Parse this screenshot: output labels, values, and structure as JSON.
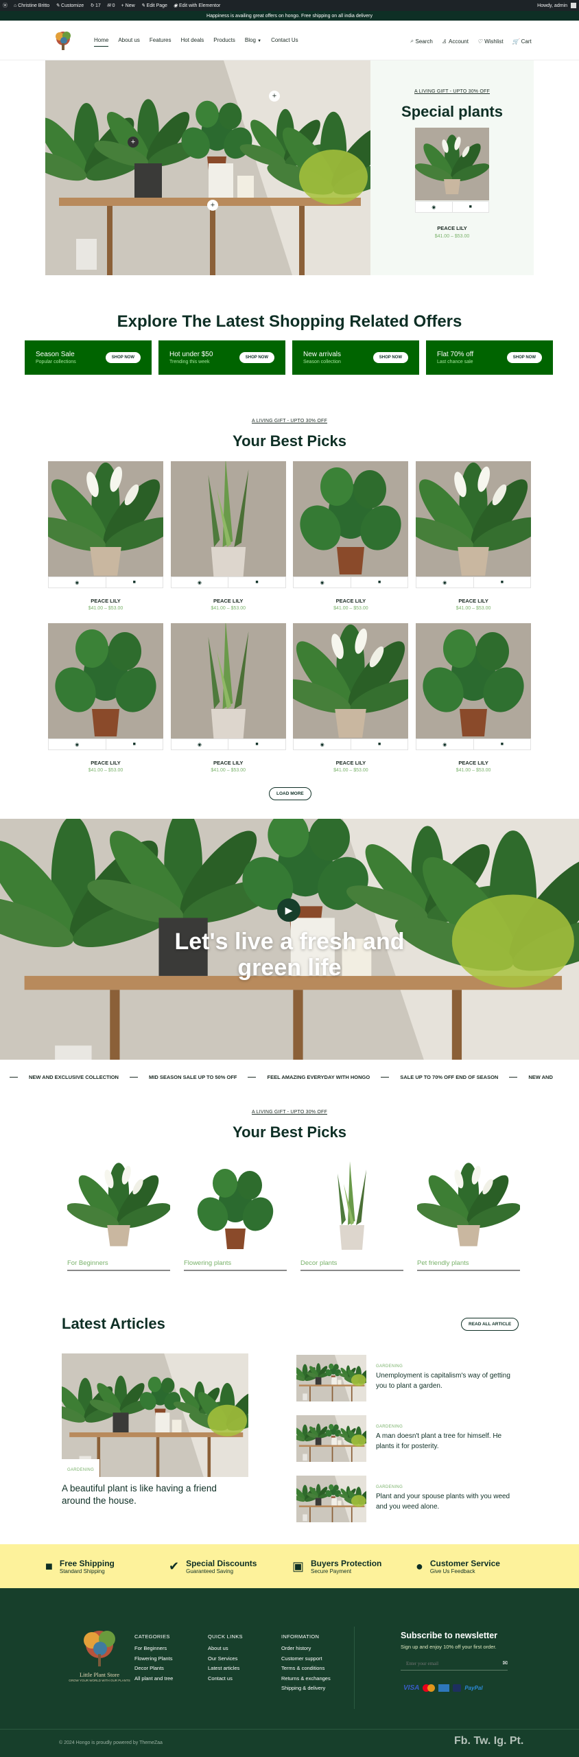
{
  "adminbar": {
    "user": "Christine Britto",
    "customize": "Customize",
    "updates": "17",
    "comments": "0",
    "new": "New",
    "edit": "Edit Page",
    "elementor": "Edit with Elementor",
    "howdy": "Howdy, admin"
  },
  "promo": "Happiness is availing great offers on hongo. Free shipping on all india delivery",
  "nav": {
    "items": [
      "Home",
      "About us",
      "Features",
      "Hot deals",
      "Products",
      "Blog",
      "Contact Us"
    ],
    "tools": {
      "search": "Search",
      "account": "Account",
      "wishlist": "Wishlist",
      "cart": "Cart"
    }
  },
  "hero": {
    "eyebrow": "A LIVING GIFT - UPTO 30% OFF",
    "title": "Special plants",
    "product": {
      "name": "PEACE LILY",
      "price": "$41.00 – $53.00"
    }
  },
  "offers": {
    "title": "Explore The Latest Shopping Related Offers",
    "items": [
      {
        "title": "Season Sale",
        "sub": "Popular collections",
        "btn": "SHOP NOW"
      },
      {
        "title": "Hot under $50",
        "sub": "Trending this week",
        "btn": "SHOP NOW"
      },
      {
        "title": "New arrivals",
        "sub": "Season collection",
        "btn": "SHOP NOW"
      },
      {
        "title": "Flat 70% off",
        "sub": "Last chance sale",
        "btn": "SHOP NOW"
      }
    ]
  },
  "picks": {
    "eyebrow": "A LIVING GIFT - UPTO 30% OFF",
    "title": "Your Best Picks",
    "products": [
      {
        "name": "PEACE LILY",
        "price": "$41.00 – $53.00"
      },
      {
        "name": "PEACE LILY",
        "price": "$41.00 – $53.00"
      },
      {
        "name": "PEACE LILY",
        "price": "$41.00 – $53.00"
      },
      {
        "name": "PEACE LILY",
        "price": "$41.00 – $53.00"
      },
      {
        "name": "PEACE LILY",
        "price": "$41.00 – $53.00"
      },
      {
        "name": "PEACE LILY",
        "price": "$41.00 – $53.00"
      },
      {
        "name": "PEACE LILY",
        "price": "$41.00 – $53.00"
      },
      {
        "name": "PEACE LILY",
        "price": "$41.00 – $53.00"
      }
    ],
    "load_more": "LOAD MORE"
  },
  "banner": {
    "line1": "Let's live a fresh and",
    "line2": "green life"
  },
  "marquee": [
    "NEW AND EXCLUSIVE COLLECTION",
    "MID SEASON SALE UP TO 50% OFF",
    "FEEL AMAZING EVERYDAY WITH HONGO",
    "SALE UP TO 70% OFF END OF SEASON",
    "NEW AND"
  ],
  "categories": {
    "eyebrow": "A LIVING GIFT - UPTO 30% OFF",
    "title": "Your Best Picks",
    "items": [
      "For Beginners",
      "Flowering plants",
      "Decor plants",
      "Pet friendly plants"
    ]
  },
  "articles": {
    "title": "Latest Articles",
    "btn": "READ ALL ARTICLE",
    "main": {
      "tag": "GARDENING",
      "title": "A beautiful plant is like having a friend around the house."
    },
    "side": [
      {
        "tag": "GARDENING",
        "title": "Unemployment is capitalism's way of getting you to plant a garden."
      },
      {
        "tag": "GARDENING",
        "title": "A man doesn't plant a tree for himself. He plants it for posterity."
      },
      {
        "tag": "GARDENING",
        "title": "Plant and your spouse plants with you weed and you weed alone."
      }
    ]
  },
  "features": [
    {
      "title": "Free Shipping",
      "sub": "Standard Shipping"
    },
    {
      "title": "Special Discounts",
      "sub": "Guaranteed Saving"
    },
    {
      "title": "Buyers Protection",
      "sub": "Secure Payment"
    },
    {
      "title": "Customer Service",
      "sub": "Give Us Feedback"
    }
  ],
  "footer": {
    "brand": "Little Plant Store",
    "tagline": "GROW YOUR WORLD WITH OUR PLANTS",
    "cols": [
      {
        "title": "CATEGORIES",
        "links": [
          "For Beginners",
          "Flowering Plants",
          "Decor Plants",
          "All plant and tree"
        ]
      },
      {
        "title": "QUICK LINKS",
        "links": [
          "About us",
          "Our Services",
          "Latest articles",
          "Contact us"
        ]
      },
      {
        "title": "INFORMATION",
        "links": [
          "Order history",
          "Customer support",
          "Terms & conditions",
          "Returns & exchanges",
          "Shipping & delivery"
        ]
      }
    ],
    "newsletter": {
      "title": "Subscribe to newsletter",
      "sub": "Sign up and enjoy 10% off your first order.",
      "placeholder": "Enter your email"
    },
    "payments": [
      "VISA",
      "",
      "",
      "",
      "PayPal"
    ],
    "copyright": "© 2024 Hongo is proudly powered by ThemeZaa",
    "social": "Fb. Tw. Ig. Pt."
  },
  "colors": {
    "primary": "#0e2f25",
    "offer": "#006400",
    "accent": "#7ab26b",
    "features": "#fdf29b",
    "footer": "#173f2b"
  }
}
